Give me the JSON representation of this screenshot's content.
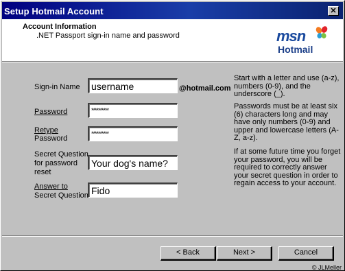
{
  "window": {
    "title": "Setup Hotmail Account",
    "close_glyph": "✕"
  },
  "header": {
    "title": "Account Information",
    "subtitle": ".NET Passport sign-in name and password",
    "logo": {
      "msn": "msn",
      "hotmail": "Hotmail"
    }
  },
  "form": {
    "signin_label": "Sign-in Name",
    "signin_value": "username",
    "domain": "@hotmail.com",
    "password_label": "Password",
    "password_value": "**********",
    "retype_label_line1": "Retype",
    "retype_label_line2": "Password",
    "retype_value": "**********",
    "secret_label_line1": "Secret Question",
    "secret_label_line2": "for password",
    "secret_label_line3": "reset",
    "secret_value": "Your dog's name?",
    "answer_label_line1": "Answer to",
    "answer_label_line2": "Secret Question",
    "answer_value": "Fido"
  },
  "help": {
    "signin_hint": "Start with a letter and use (a-z), numbers (0-9), and the underscore (_).",
    "password_hint": "Passwords must be at least six (6) characters long and may have only numbers (0-9) and upper and lowercase letters (A-Z, a-z).",
    "secret_hint": "If at some future time you forget your password, you will be required to correctly answer your secret question in order to regain access to your account."
  },
  "buttons": {
    "back": "< Back",
    "next": "Next >",
    "cancel": "Cancel"
  },
  "footer": {
    "copyright": "© JLMeller"
  }
}
